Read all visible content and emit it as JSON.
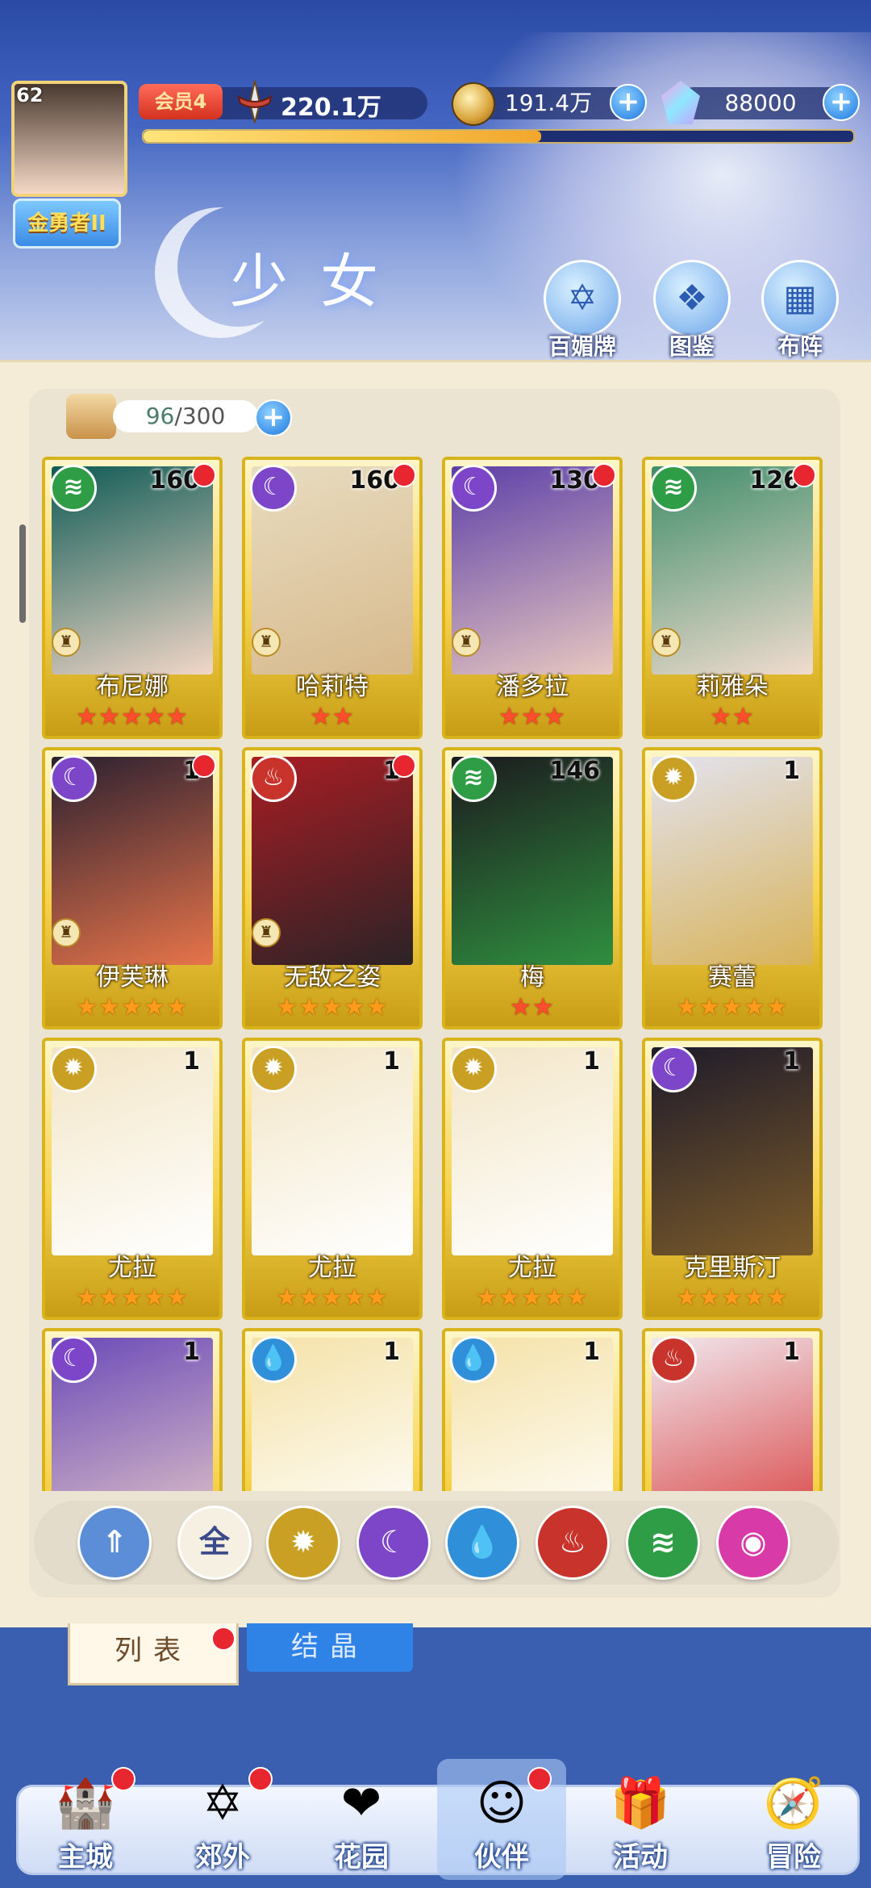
{
  "header": {
    "level": "62",
    "rank": "金勇者II",
    "vip": "会员4",
    "power": "220.1万",
    "gold": "191.4万",
    "gems": "88000",
    "xp_fraction": 0.56,
    "page_title": "少女",
    "buttons": [
      {
        "label": "百媚牌",
        "icon": "hexagram-card-icon"
      },
      {
        "label": "图鉴",
        "icon": "book-icon"
      },
      {
        "label": "布阵",
        "icon": "grid-formation-icon"
      }
    ]
  },
  "capacity": {
    "current": "96",
    "sep": "/",
    "max": "300"
  },
  "element_colors": {
    "wind": "#2f9d45",
    "moon": "#7d45c8",
    "fire": "#c8342c",
    "light": "#c9a024",
    "water": "#2f8fd8"
  },
  "cards": [
    {
      "name": "布尼娜",
      "level": "160",
      "element": "wind",
      "stars": 5,
      "star_color": "red",
      "dot": true,
      "chess": true,
      "art": [
        "#0f5b55",
        "#f2d7c8"
      ]
    },
    {
      "name": "哈莉特",
      "level": "160",
      "element": "moon",
      "stars": 2,
      "star_color": "red",
      "dot": true,
      "chess": true,
      "art": [
        "#e8dcc0",
        "#d7b98c"
      ]
    },
    {
      "name": "潘多拉",
      "level": "130",
      "element": "moon",
      "stars": 3,
      "star_color": "red",
      "dot": true,
      "chess": true,
      "art": [
        "#5c3fa8",
        "#e8c8c0"
      ]
    },
    {
      "name": "莉雅朵",
      "level": "126",
      "element": "wind",
      "stars": 2,
      "star_color": "red",
      "dot": true,
      "chess": true,
      "art": [
        "#3f8d6a",
        "#f1dccf"
      ]
    },
    {
      "name": "伊芙琳",
      "level": "1",
      "element": "moon",
      "stars": 5,
      "star_color": "gold",
      "dot": true,
      "chess": true,
      "art": [
        "#2b2030",
        "#e7744a"
      ]
    },
    {
      "name": "无敌之姿",
      "level": "1",
      "element": "fire",
      "stars": 5,
      "star_color": "gold",
      "dot": true,
      "chess": true,
      "art": [
        "#a81d24",
        "#2b2326"
      ]
    },
    {
      "name": "梅",
      "level": "146",
      "element": "wind",
      "stars": 2,
      "star_color": "red",
      "dot": false,
      "chess": false,
      "art": [
        "#1c1a1e",
        "#2f8f3f"
      ]
    },
    {
      "name": "赛蕾",
      "level": "1",
      "element": "light",
      "stars": 5,
      "star_color": "gold",
      "dot": false,
      "chess": false,
      "art": [
        "#e3e3ef",
        "#d8b35a"
      ]
    },
    {
      "name": "尤拉",
      "level": "1",
      "element": "light",
      "stars": 5,
      "star_color": "gold",
      "dot": false,
      "chess": false,
      "art": [
        "#f3e6c7",
        "#ffffff"
      ]
    },
    {
      "name": "尤拉",
      "level": "1",
      "element": "light",
      "stars": 5,
      "star_color": "gold",
      "dot": false,
      "chess": false,
      "art": [
        "#f3e6c7",
        "#ffffff"
      ]
    },
    {
      "name": "尤拉",
      "level": "1",
      "element": "light",
      "stars": 5,
      "star_color": "gold",
      "dot": false,
      "chess": false,
      "art": [
        "#f3e6c7",
        "#ffffff"
      ]
    },
    {
      "name": "克里斯汀",
      "level": "1",
      "element": "moon",
      "stars": 5,
      "star_color": "gold",
      "dot": false,
      "chess": false,
      "art": [
        "#1f1b2a",
        "#7a5a2a"
      ]
    },
    {
      "name": "",
      "level": "1",
      "element": "moon",
      "stars": 0,
      "star_color": "gold",
      "dot": false,
      "chess": false,
      "art": [
        "#6a4ab8",
        "#e5c8c8"
      ]
    },
    {
      "name": "",
      "level": "1",
      "element": "water",
      "stars": 0,
      "star_color": "gold",
      "dot": false,
      "chess": false,
      "art": [
        "#f5e2a8",
        "#ffffff"
      ]
    },
    {
      "name": "",
      "level": "1",
      "element": "water",
      "stars": 0,
      "star_color": "gold",
      "dot": false,
      "chess": false,
      "art": [
        "#f5e2a8",
        "#ffffff"
      ]
    },
    {
      "name": "",
      "level": "1",
      "element": "fire",
      "stars": 0,
      "star_color": "gold",
      "dot": false,
      "chess": false,
      "art": [
        "#f0e8ee",
        "#d83a3a"
      ]
    }
  ],
  "filters": [
    {
      "label": "",
      "icon": "sort-up-icon",
      "color": "#5b8ed6"
    },
    {
      "label": "全",
      "icon": "all-filter-icon",
      "color": "#f6f0e2"
    },
    {
      "label": "",
      "icon": "light-element-icon",
      "color": "#c9a024"
    },
    {
      "label": "",
      "icon": "moon-element-icon",
      "color": "#7d45c8"
    },
    {
      "label": "",
      "icon": "water-element-icon",
      "color": "#2f8fd8"
    },
    {
      "label": "",
      "icon": "fire-element-icon",
      "color": "#c8342c"
    },
    {
      "label": "",
      "icon": "wind-element-icon",
      "color": "#2f9d45"
    },
    {
      "label": "",
      "icon": "star-element-icon",
      "color": "#d83aa8"
    }
  ],
  "tabs": {
    "list": "列表",
    "crystal": "结晶"
  },
  "nav": [
    {
      "label": "主城",
      "icon": "castle-icon",
      "dot": true
    },
    {
      "label": "郊外",
      "icon": "portal-icon",
      "dot": true
    },
    {
      "label": "花园",
      "icon": "heart-icon",
      "dot": false
    },
    {
      "label": "伙伴",
      "icon": "partner-icon",
      "dot": true,
      "active": true
    },
    {
      "label": "活动",
      "icon": "gift-icon",
      "dot": false
    },
    {
      "label": "冒险",
      "icon": "compass-icon",
      "dot": false
    }
  ]
}
